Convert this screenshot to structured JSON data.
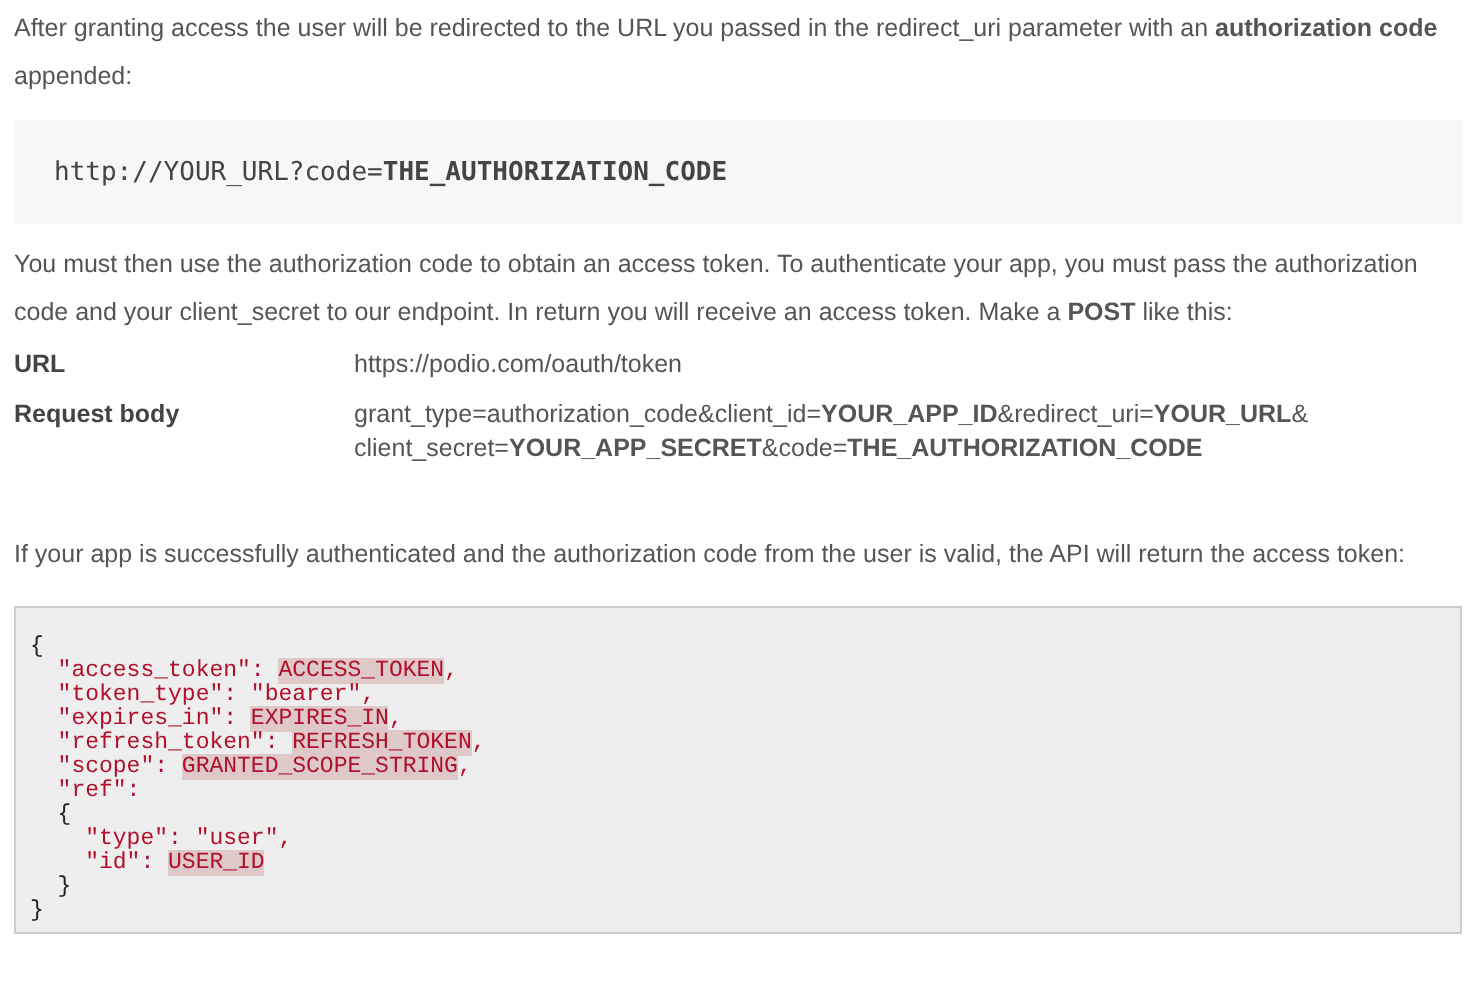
{
  "intro": "After granting access the user will be redirected to the URL you passed in the redirect_uri parameter with an **authorization code** appended:",
  "redirect_example": "http://YOUR_URL?code=**THE_AUTHORIZATION_CODE**",
  "instructions": "You must then use the authorization code to obtain an access token. To authenticate your app, you must pass the authorization code and your client_secret to our endpoint. In return you will receive an access token. Make a **POST** like this:",
  "request": [
    {
      "label": "URL",
      "value_lines": [
        "https://podio.com/oauth/token"
      ]
    },
    {
      "label": "Request body",
      "value_lines": [
        "grant_type=authorization_code&client_id=**YOUR_APP_ID**&redirect_uri=**YOUR_URL**&",
        "client_secret=**YOUR_APP_SECRET**&code=**THE_AUTHORIZATION_CODE**"
      ]
    }
  ],
  "result_text": "If your app is successfully authenticated and the authorization code from the user is valid, the API will return the access token:",
  "response_lines": [
    {
      "kind": "brace",
      "code": "{"
    },
    {
      "kind": "pair",
      "code": "  \"access_token\": ",
      "value": "ACCESS_TOKEN",
      "tail": ","
    },
    {
      "kind": "pair",
      "code": "  \"token_type\": \"bearer\","
    },
    {
      "kind": "pair",
      "code": "  \"expires_in\": ",
      "value": "EXPIRES_IN",
      "tail": ","
    },
    {
      "kind": "pair",
      "code": "  \"refresh_token\": ",
      "value": "REFRESH_TOKEN",
      "tail": ","
    },
    {
      "kind": "pair",
      "code": "  \"scope\": ",
      "value": "GRANTED_SCOPE_STRING",
      "tail": ","
    },
    {
      "kind": "pair",
      "code": "  \"ref\":"
    },
    {
      "kind": "brace",
      "code": "  {"
    },
    {
      "kind": "pair",
      "code": "    \"type\": \"user\","
    },
    {
      "kind": "pair",
      "code": "    \"id\": ",
      "value": "USER_ID"
    },
    {
      "kind": "brace",
      "code": "  }"
    },
    {
      "kind": "brace",
      "code": "}"
    }
  ]
}
